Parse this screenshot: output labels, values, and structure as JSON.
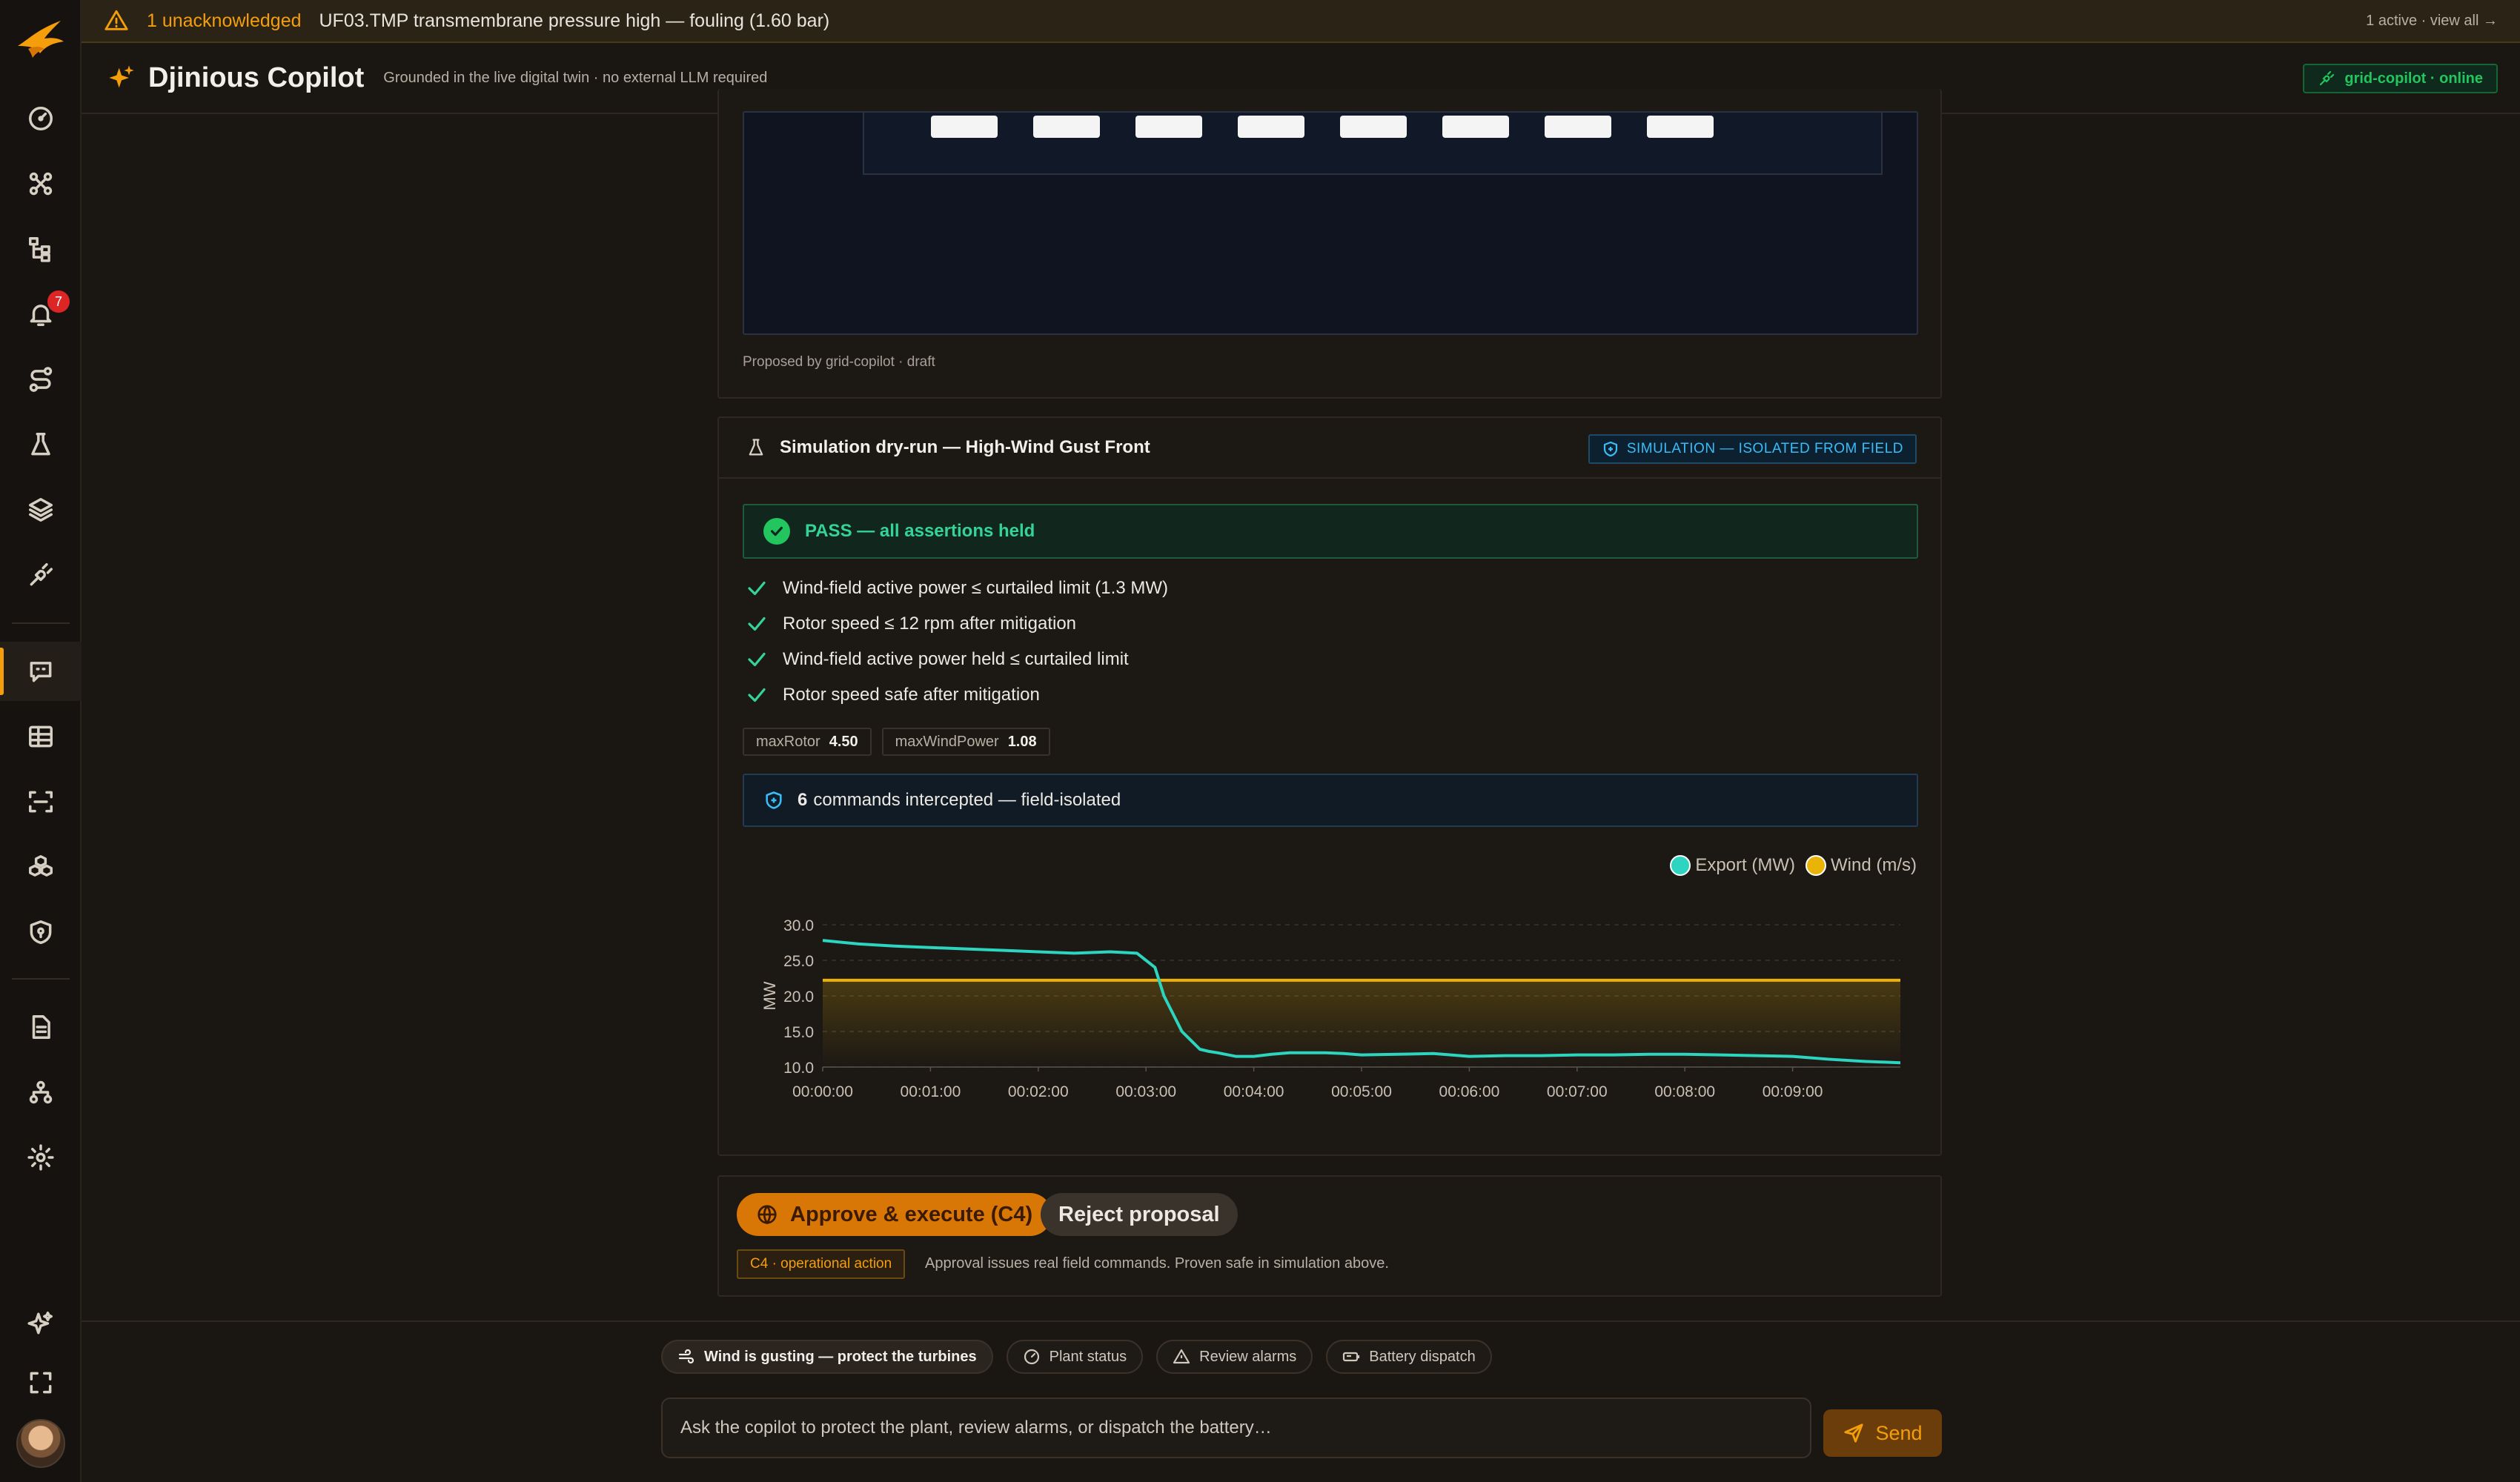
{
  "alert": {
    "unacknowledged": "1 unacknowledged",
    "message": "UF03.TMP transmembrane pressure high — fouling (1.60 bar)",
    "summary": "1 active · view all →"
  },
  "header": {
    "title": "Djinious Copilot",
    "subtitle": "Grounded in the live digital twin · no external LLM required",
    "status": "grid-copilot · online"
  },
  "sidebar": {
    "alarm_count": "7",
    "icons": [
      "gauge-icon",
      "topology-icon",
      "hierarchy-icon",
      "bell-icon",
      "route-icon",
      "flask-icon",
      "layers-icon",
      "plug-icon",
      "chat-icon",
      "grid-icon",
      "scan-icon",
      "cubes-icon",
      "shield-icon",
      "document-icon",
      "org-chart-icon",
      "gear-icon",
      "sparkles-icon",
      "fullscreen-icon"
    ]
  },
  "proposal": {
    "footer": "Proposed by grid-copilot · draft"
  },
  "simulation": {
    "title": "Simulation dry-run — High-Wind Gust Front",
    "tag": "SIMULATION — ISOLATED FROM FIELD",
    "result": "PASS — all assertions held",
    "assertions": [
      "Wind-field active power ≤ curtailed limit (1.3 MW)",
      "Rotor speed ≤ 12 rpm after mitigation",
      "Wind-field active power held ≤ curtailed limit",
      "Rotor speed safe after mitigation"
    ],
    "metrics": [
      {
        "label": "maxRotor",
        "value": "4.50"
      },
      {
        "label": "maxWindPower",
        "value": "1.08"
      }
    ],
    "intercept_count": "6",
    "intercept_text": "commands intercepted — field-isolated"
  },
  "chart_data": {
    "type": "line",
    "ylabel": "MW",
    "xlabel": "",
    "ylim": [
      10,
      30
    ],
    "yticks": [
      "30.0",
      "25.0",
      "20.0",
      "15.0",
      "10.0"
    ],
    "xticks": [
      "00:00:00",
      "00:01:00",
      "00:02:00",
      "00:03:00",
      "00:04:00",
      "00:05:00",
      "00:06:00",
      "00:07:00",
      "00:08:00",
      "00:09:00"
    ],
    "xrange_seconds": [
      0,
      600
    ],
    "grid": true,
    "legend": "top-right",
    "series": [
      {
        "name": "Export (MW)",
        "color": "#2dd4bf",
        "t": [
          0,
          20,
          40,
          60,
          80,
          100,
          120,
          140,
          160,
          175,
          185,
          190,
          200,
          210,
          215,
          220,
          230,
          240,
          250,
          260,
          270,
          280,
          290,
          300,
          320,
          340,
          360,
          380,
          400,
          420,
          440,
          460,
          480,
          500,
          520,
          540,
          560,
          580,
          600
        ],
        "values": [
          27.8,
          27.3,
          27.0,
          26.8,
          26.6,
          26.4,
          26.2,
          26.0,
          26.2,
          26.0,
          24.0,
          20.0,
          15.0,
          12.5,
          12.2,
          12.0,
          11.5,
          11.5,
          11.8,
          12.0,
          12.0,
          12.0,
          11.9,
          11.7,
          11.8,
          11.9,
          11.5,
          11.6,
          11.6,
          11.7,
          11.7,
          11.8,
          11.8,
          11.7,
          11.6,
          11.5,
          11.1,
          10.8,
          10.6
        ]
      },
      {
        "name": "Wind (m/s)",
        "color": "#eab308",
        "t": [
          0,
          600
        ],
        "values": [
          22.2,
          22.2
        ]
      }
    ]
  },
  "actions": {
    "approve": "Approve & execute (C4)",
    "reject": "Reject proposal",
    "class_tag": "C4 · operational action",
    "note": "Approval issues real field commands. Proven safe in simulation above."
  },
  "composer": {
    "suggestions": [
      "Wind is gusting — protect the turbines",
      "Plant status",
      "Review alarms",
      "Battery dispatch"
    ],
    "placeholder": "Ask the copilot to protect the plant, review alarms, or dispatch the battery…",
    "send": "Send"
  }
}
